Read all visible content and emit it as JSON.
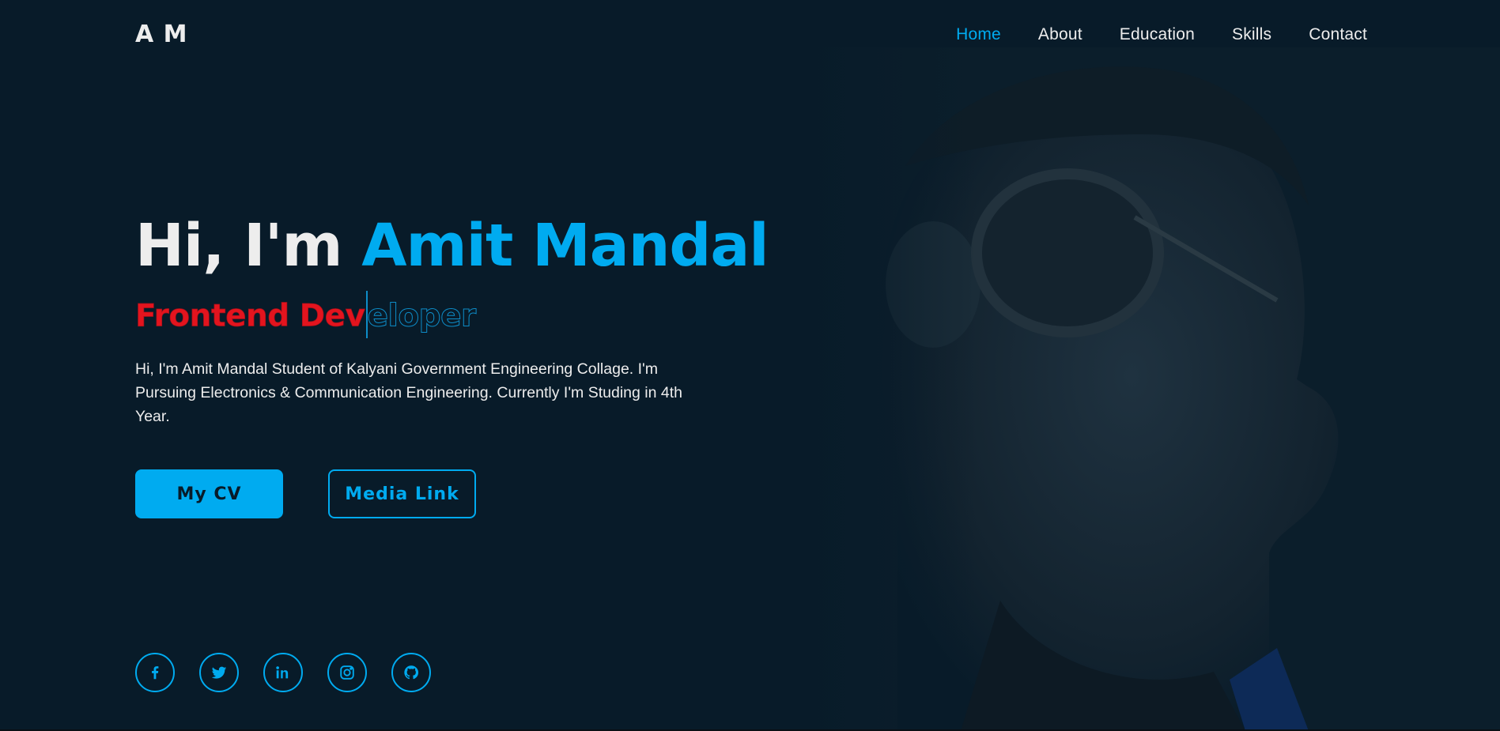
{
  "header": {
    "logo": "A M",
    "nav": [
      {
        "label": "Home",
        "active": true
      },
      {
        "label": "About",
        "active": false
      },
      {
        "label": "Education",
        "active": false
      },
      {
        "label": "Skills",
        "active": false
      },
      {
        "label": "Contact",
        "active": false
      }
    ]
  },
  "hero": {
    "greeting": "Hi, I'm",
    "name": "Amit Mandal",
    "role_typed": "Frontend Dev",
    "role_remaining": "eloper",
    "description": "Hi, I'm Amit Mandal Student of Kalyani Government Engineering Collage. I'm Pursuing Electronics & Communication Engineering. Currently I'm Studing in 4th Year.",
    "buttons": {
      "primary": "My CV",
      "secondary": "Media Link"
    }
  },
  "socials": [
    {
      "icon": "facebook-icon"
    },
    {
      "icon": "twitter-icon"
    },
    {
      "icon": "linkedin-icon"
    },
    {
      "icon": "instagram-icon"
    },
    {
      "icon": "github-icon"
    }
  ],
  "colors": {
    "background": "#081b29",
    "accent": "#00abf0",
    "text": "#ededed",
    "role_highlight": "#e3141e"
  }
}
